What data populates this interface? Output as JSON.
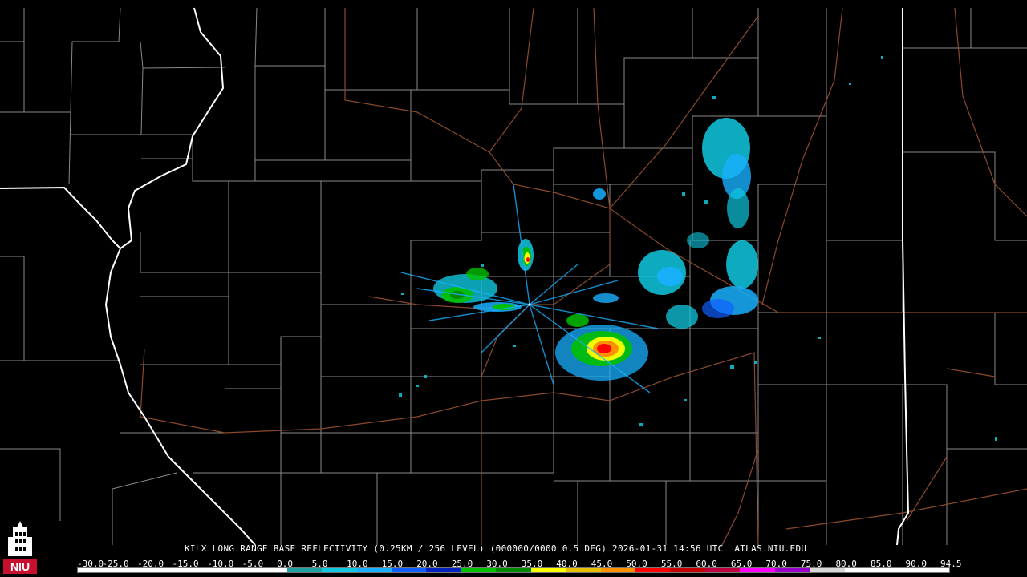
{
  "product": {
    "caption": "KILX LONG RANGE BASE REFLECTIVITY (0.25KM / 256 LEVEL) (000000/0000 0.5 DEG) 2026-01-31 14:56 UTC  ATLAS.NIU.EDU"
  },
  "logo": {
    "text": "NIU",
    "icon": "university-tower-logo-icon",
    "color": "#c8102e"
  },
  "colors": {
    "background": "#000000",
    "county_lines": "#8a8a8a",
    "state_lines": "#ffffff",
    "highways": "#8b4a2b"
  },
  "scale": {
    "labels": [
      "-30.0",
      "-25.0",
      "-20.0",
      "-15.0",
      "-10.0",
      "-5.0",
      "0.0",
      "5.0",
      "10.0",
      "15.0",
      "20.0",
      "25.0",
      "30.0",
      "35.0",
      "40.0",
      "45.0",
      "50.0",
      "55.0",
      "60.0",
      "65.0",
      "70.0",
      "75.0",
      "80.0",
      "85.0",
      "90.0",
      "94.5"
    ],
    "colors": [
      "#ffffff",
      "#ffffff",
      "#ffffff",
      "#ffffff",
      "#ffffff",
      "#ffffff",
      "#1fa0a0",
      "#10c8e0",
      "#18b0ff",
      "#1060ff",
      "#0020c0",
      "#00c000",
      "#008800",
      "#ffff00",
      "#e8c000",
      "#ff9000",
      "#ff0000",
      "#c80000",
      "#c00040",
      "#ff00ff",
      "#9900cc",
      "#d8d8d8",
      "#ffffff",
      "#ffffff",
      "#ffffff"
    ]
  }
}
